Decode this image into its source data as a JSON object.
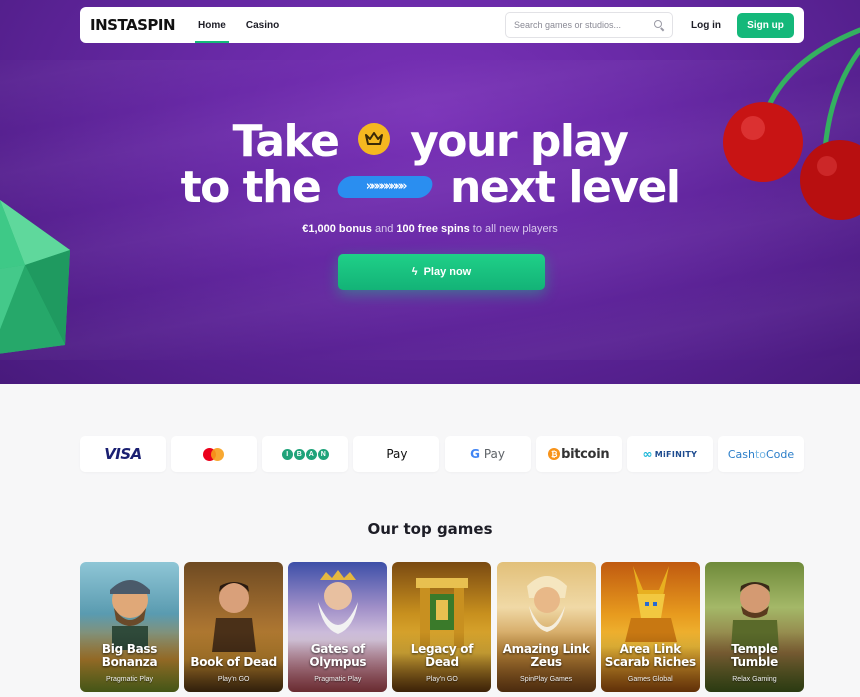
{
  "nav": {
    "logo": "INSTASPIN",
    "links": [
      "Home",
      "Casino"
    ],
    "search_placeholder": "Search games or studios...",
    "login_label": "Log in",
    "signup_label": "Sign up"
  },
  "hero": {
    "line1_a": "Take",
    "line1_b": "your play",
    "line2_a": "to the",
    "line2_b": "next level",
    "arrows": "»»»»»»»»",
    "bonus": "€1,000 bonus",
    "and": " and ",
    "spins": "100 free spins",
    "rest": " to all new players",
    "cta": "Play now"
  },
  "payments": {
    "visa": "VISA",
    "iban": [
      "I",
      "B",
      "A",
      "N"
    ],
    "apple_pay": "Pay",
    "google_pay_g": "G",
    "google_pay": " Pay",
    "bitcoin": "bitcoin",
    "mifinity": "MiFINITY",
    "cashto_a": "Cash",
    "cashto_b": "to",
    "cashto_c": "Code"
  },
  "games_section": {
    "title": "Our top games",
    "games": [
      {
        "title": "Big Bass Bonanza",
        "studio": "Pragmatic Play"
      },
      {
        "title": "Book of Dead",
        "studio": "Play'n GO"
      },
      {
        "title": "Gates of Olympus",
        "studio": "Pragmatic Play"
      },
      {
        "title": "Legacy of Dead",
        "studio": "Play'n GO"
      },
      {
        "title": "Amazing Link Zeus",
        "studio": "SpinPlay Games"
      },
      {
        "title": "Area Link Scarab Riches",
        "studio": "Games Global"
      },
      {
        "title": "Temple Tumble",
        "studio": "Relax Gaming"
      }
    ]
  },
  "colors": {
    "brand_green": "#14b87a",
    "hero_purple": "#6a2aa8",
    "crown_yellow": "#f5b820",
    "arrow_blue": "#2a8ef0"
  },
  "icons": [
    "search-icon",
    "crown-icon",
    "bolt-icon",
    "apple-icon",
    "bitcoin-icon"
  ]
}
